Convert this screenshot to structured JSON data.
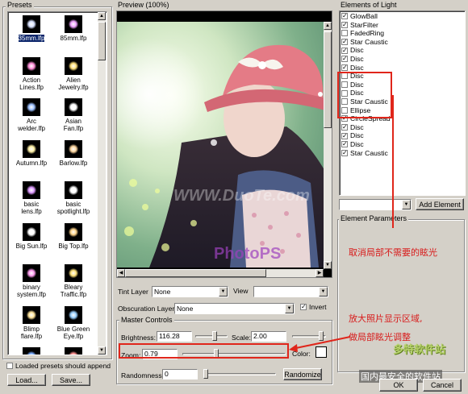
{
  "presets": {
    "title": "Presets",
    "items": [
      {
        "label": "35mm.lfp",
        "selected": true
      },
      {
        "label": "85mm.lfp",
        "selected": false
      },
      {
        "label": "Action Lines.lfp",
        "selected": false
      },
      {
        "label": "Alien Jewelry.lfp",
        "selected": false
      },
      {
        "label": "Arc welder.lfp",
        "selected": false
      },
      {
        "label": "Asian Fan.lfp",
        "selected": false
      },
      {
        "label": "Autumn.lfp",
        "selected": false
      },
      {
        "label": "Barlow.lfp",
        "selected": false
      },
      {
        "label": "basic lens.lfp",
        "selected": false
      },
      {
        "label": "basic spotlight.lfp",
        "selected": false
      },
      {
        "label": "Big Sun.lfp",
        "selected": false
      },
      {
        "label": "Big Top.lfp",
        "selected": false
      },
      {
        "label": "binary system.lfp",
        "selected": false
      },
      {
        "label": "Bleary Traffic.lfp",
        "selected": false
      },
      {
        "label": "Blimp flare.lfp",
        "selected": false
      },
      {
        "label": "Blue Green Eye.lfp",
        "selected": false
      },
      {
        "label": "",
        "selected": false
      },
      {
        "label": "",
        "selected": false
      }
    ],
    "loaded_should_append_label": "Loaded presets should append",
    "loaded_should_append_checked": false,
    "load_button": "Load...",
    "save_button": "Save..."
  },
  "preview": {
    "title": "Preview (100%)",
    "watermark_center": "WWW.DuoTe.com",
    "watermark_bottom_prefix": "PhotoPS"
  },
  "layers": {
    "tint_label": "Tint Layer",
    "tint_value": "None",
    "view_label": "View",
    "view_value": "",
    "obscuration_label": "Obscuration Layer",
    "obscuration_value": "None",
    "invert_label": "Invert",
    "invert_checked": true
  },
  "master": {
    "title": "Master Controls",
    "brightness_label": "Brightness:",
    "brightness_value": "116.28",
    "brightness_level": 0.62,
    "scale_label": "Scale:",
    "scale_value": "2.00",
    "scale_level": 0.92,
    "zoom_label": "Zoom:",
    "zoom_value": "0.79",
    "zoom_level": 0.32,
    "color_label": "Color:",
    "color_value": "#ffffff",
    "randomness_label": "Randomness:",
    "randomness_value": "0",
    "randomness_level": 0.0,
    "randomize_button": "Randomize"
  },
  "elements": {
    "title": "Elements of Light",
    "items": [
      {
        "label": "GlowBall",
        "checked": true
      },
      {
        "label": "StarFilter",
        "checked": true
      },
      {
        "label": "FadedRing",
        "checked": false
      },
      {
        "label": "Star Caustic",
        "checked": true
      },
      {
        "label": "Disc",
        "checked": true
      },
      {
        "label": "Disc",
        "checked": true
      },
      {
        "label": "Disc",
        "checked": true
      },
      {
        "label": "Disc",
        "checked": false
      },
      {
        "label": "Disc",
        "checked": false
      },
      {
        "label": "Disc",
        "checked": false
      },
      {
        "label": "Star Caustic",
        "checked": false
      },
      {
        "label": "Ellipse",
        "checked": false
      },
      {
        "label": "CircleSpread",
        "checked": true
      },
      {
        "label": "Disc",
        "checked": true
      },
      {
        "label": "Disc",
        "checked": true
      },
      {
        "label": "Disc",
        "checked": true
      },
      {
        "label": "Star Caustic",
        "checked": true
      }
    ],
    "add_combo_value": "",
    "add_button": "Add Element",
    "params_title": "Element Parameters"
  },
  "annotations": {
    "cancel_local_flare": "取消局部不需要的眩光",
    "zoom_hint_line1": "放大照片显示区域,",
    "zoom_hint_line2": "做局部眩光调整",
    "site_logo": "多特软件站",
    "site_slogan": "国内最安全的软件站"
  },
  "dialog": {
    "ok_button": "OK",
    "cancel_button": "Cancel"
  },
  "colors": {
    "annotation_red": "#e0261b",
    "selection_blue": "#0a246a"
  }
}
